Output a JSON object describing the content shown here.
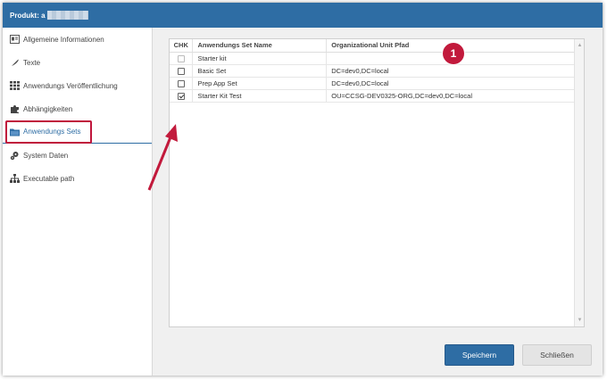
{
  "window": {
    "title_prefix": "Produkt: a"
  },
  "sidebar": {
    "items": [
      {
        "label": "Allgemeine Informationen",
        "icon": "id-card-icon"
      },
      {
        "label": "Texte",
        "icon": "feather-icon"
      },
      {
        "label": "Anwendungs Veröffentlichung",
        "icon": "grid-icon"
      },
      {
        "label": "Abhängigkeiten",
        "icon": "puzzle-icon"
      },
      {
        "label": "Anwendungs Sets",
        "icon": "folder-icon",
        "active": true
      },
      {
        "label": "System Daten",
        "icon": "gears-icon"
      },
      {
        "label": "Executable path",
        "icon": "sitemap-icon"
      }
    ]
  },
  "grid": {
    "headers": {
      "chk": "CHK",
      "name": "Anwendungs Set Name",
      "ou": "Organizational Unit Pfad"
    },
    "rows": [
      {
        "checked": false,
        "disabled": true,
        "name": "Starter kit",
        "ou": ""
      },
      {
        "checked": false,
        "disabled": false,
        "name": "Basic Set",
        "ou": "DC=dev0,DC=local"
      },
      {
        "checked": false,
        "disabled": false,
        "name": "Prep App Set",
        "ou": "DC=dev0,DC=local"
      },
      {
        "checked": true,
        "disabled": false,
        "name": "Starter Kit Test",
        "ou": "OU=CCSG-DEV0325-ORG,DC=dev0,DC=local"
      }
    ]
  },
  "annotation": {
    "badge": "1"
  },
  "buttons": {
    "save": "Speichern",
    "close": "Schließen"
  },
  "colors": {
    "accent": "#2e6da4",
    "highlight": "#c0163c",
    "badge": "#c21a3c"
  }
}
